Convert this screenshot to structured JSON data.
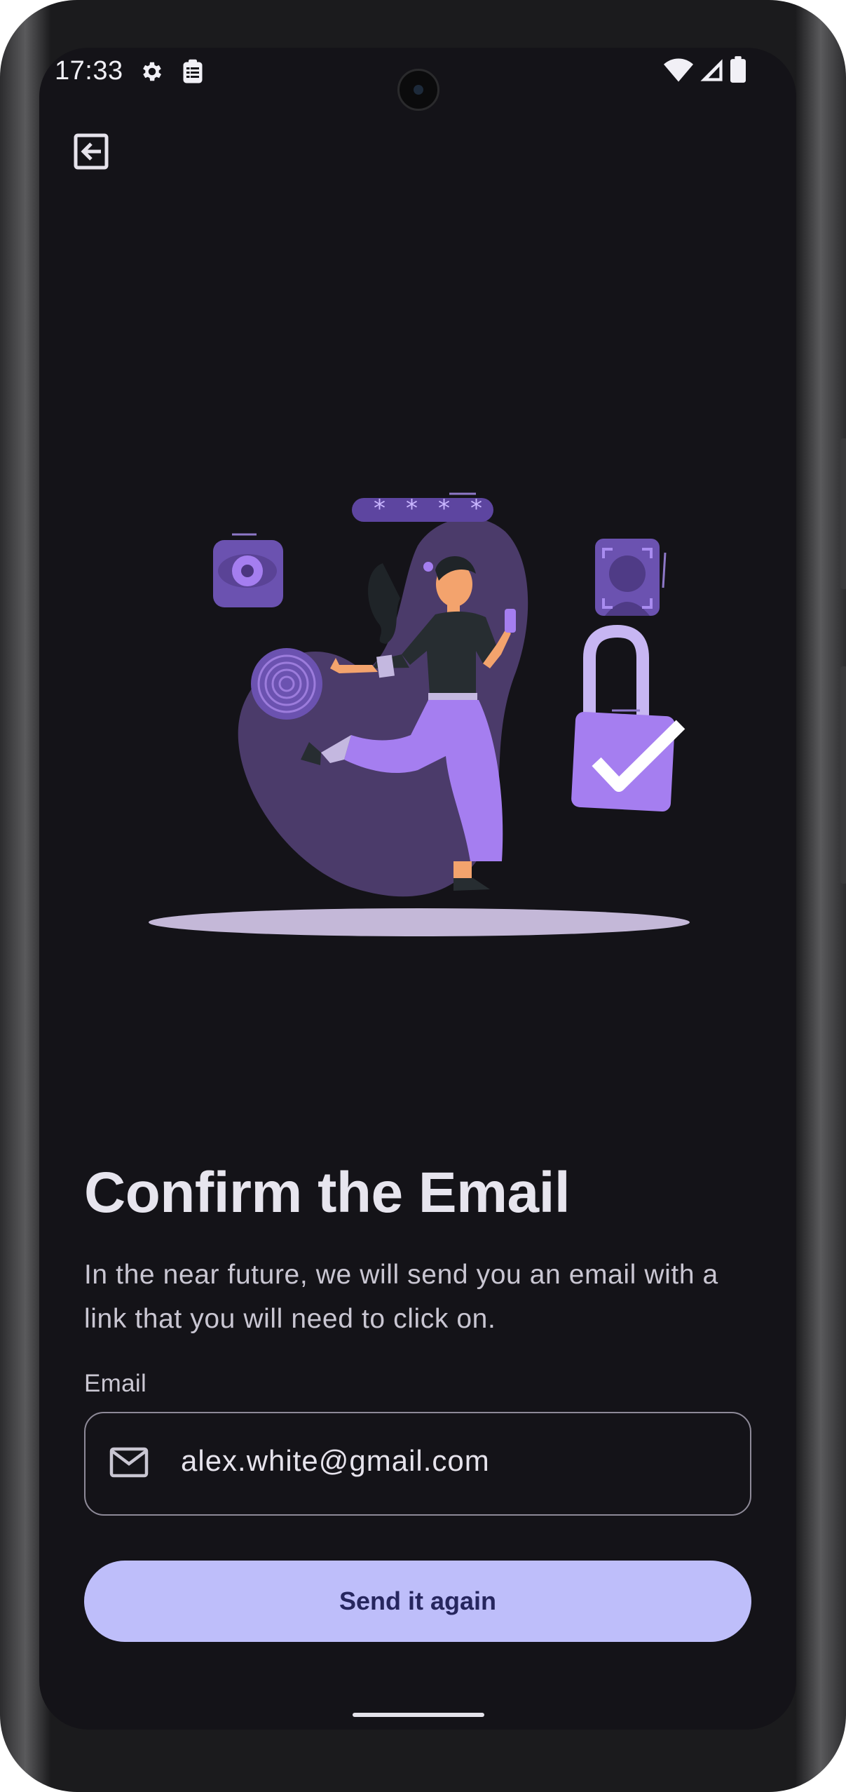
{
  "status_bar": {
    "time": "17:33"
  },
  "header": {
    "back_icon": "exit-arrow-icon"
  },
  "content": {
    "title": "Confirm the Email",
    "subtitle": "In the near future, we will send you an email with a link that you will need to click on.",
    "email_label": "Email",
    "email_value": "alex.white@gmail.com",
    "email_icon": "mail-icon"
  },
  "actions": {
    "send_again_label": "Send it again"
  },
  "colors": {
    "background": "#141318",
    "accent": "#a57ef0",
    "button": "#bebefa",
    "button_text": "#26265e"
  }
}
